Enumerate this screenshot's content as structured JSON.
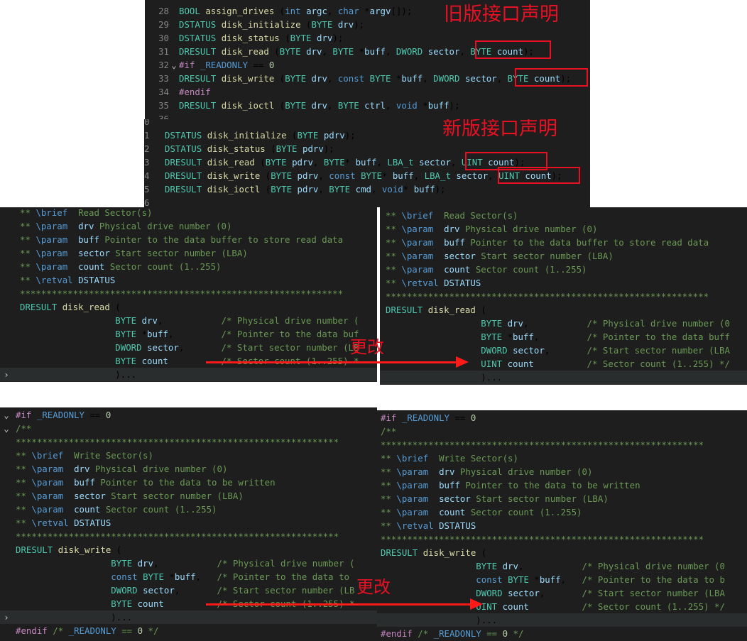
{
  "old_header": {
    "title": "旧版接口声明",
    "lines": [
      {
        "n": "28",
        "code": "BOOL assign_drives (int argc, char *argv[]);"
      },
      {
        "n": "29",
        "code": "DSTATUS disk_initialize (BYTE drv);"
      },
      {
        "n": "30",
        "code": "DSTATUS disk_status (BYTE drv);"
      },
      {
        "n": "31",
        "code": "DRESULT disk_read (BYTE drv, BYTE *buff, DWORD sector, BYTE count);"
      },
      {
        "n": "32",
        "code": "#if _READONLY == 0"
      },
      {
        "n": "33",
        "code": "DRESULT disk_write (BYTE drv, const BYTE *buff, DWORD sector, BYTE count);"
      },
      {
        "n": "34",
        "code": "#endif"
      },
      {
        "n": "35",
        "code": "DRESULT disk_ioctl (BYTE drv, BYTE ctrl, void *buff);"
      },
      {
        "n": "36",
        "code": ""
      }
    ]
  },
  "new_header": {
    "title": "新版接口声明",
    "lines": [
      {
        "n": "0",
        "code": ""
      },
      {
        "n": "1",
        "code": "DSTATUS disk_initialize (BYTE pdrv);"
      },
      {
        "n": "2",
        "code": "DSTATUS disk_status (BYTE pdrv);"
      },
      {
        "n": "3",
        "code": "DRESULT disk_read (BYTE pdrv, BYTE* buff, LBA_t sector, UINT count);"
      },
      {
        "n": "4",
        "code": "DRESULT disk_write (BYTE pdrv, const BYTE* buff, LBA_t sector, UINT count);"
      },
      {
        "n": "5",
        "code": "DRESULT disk_ioctl (BYTE pdrv, BYTE cmd, void* buff);"
      },
      {
        "n": "6",
        "code": ""
      }
    ]
  },
  "read_left": [
    "** \\brief  Read Sector(s)",
    "** \\param  drv Physical drive number (0)",
    "** \\param  buff Pointer to the data buffer to store read data",
    "** \\param  sector Start sector number (LBA)",
    "** \\param  count Sector count (1..255)",
    "** \\retval DSTATUS",
    "*************************************************************",
    "DRESULT disk_read (",
    "                  BYTE drv,           /* Physical drive number (",
    "                  BYTE *buff,         /* Pointer to the data buf",
    "                  DWORD sector,       /* Start sector number (LB",
    "                  BYTE count          /* Sector count (1..255) *",
    "                  )..."
  ],
  "read_right": [
    "** \\brief  Read Sector(s)",
    "** \\param  drv Physical drive number (0)",
    "** \\param  buff Pointer to the data buffer to store read data",
    "** \\param  sector Start sector number (LBA)",
    "** \\param  count Sector count (1..255)",
    "** \\retval DSTATUS",
    "*************************************************************",
    "DRESULT disk_read (",
    "                  BYTE drv,           /* Physical drive number (0",
    "                  BYTE *buff,         /* Pointer to the data buff",
    "                  DWORD sector,       /* Start sector number (LBA",
    "                  UINT count          /* Sector count (1..255) */",
    "                  )..."
  ],
  "write_left": [
    "#if _READONLY == 0",
    "/**",
    "*************************************************************",
    "** \\brief  Write Sector(s)",
    "** \\param  drv Physical drive number (0)",
    "** \\param  buff Pointer to the data to be written",
    "** \\param  sector Start sector number (LBA)",
    "** \\param  count Sector count (1..255)",
    "** \\retval DSTATUS",
    "*************************************************************",
    "DRESULT disk_write (",
    "                  BYTE drv,           /* Physical drive number (",
    "                  const BYTE *buff,   /* Pointer to the data to",
    "                  DWORD sector,       /* Start sector number (LB",
    "                  BYTE count          /* Sector count (1..255) *",
    "                  )...",
    "#endif /* _READONLY == 0 */"
  ],
  "write_right": [
    "#if _READONLY == 0",
    "/**",
    "*************************************************************",
    "** \\brief  Write Sector(s)",
    "** \\param  drv Physical drive number (0)",
    "** \\param  buff Pointer to the data to be written",
    "** \\param  sector Start sector number (LBA)",
    "** \\param  count Sector count (1..255)",
    "** \\retval DSTATUS",
    "*************************************************************",
    "DRESULT disk_write (",
    "                  BYTE drv,           /* Physical drive number (0",
    "                  const BYTE *buff,   /* Pointer to the data to b",
    "                  DWORD sector,       /* Start sector number (LBA",
    "                  UINT count          /* Sector count (1..255) */",
    "                  )...",
    "#endif /* _READONLY == 0 */"
  ],
  "annotations": {
    "change_label": "更改"
  },
  "colors": {
    "editor_bg": "#1e1e1e",
    "highlight": "#e81123",
    "arrow": "#ff1a1a"
  }
}
